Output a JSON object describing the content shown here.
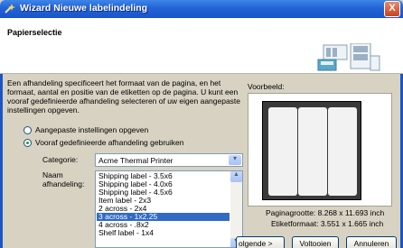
{
  "window": {
    "title": "Wizard Nieuwe labelindeling",
    "close_label": "X"
  },
  "header": {
    "title": "Papierselectie"
  },
  "description": "Een afhandeling specificeert het formaat van de pagina, en het formaat, aantal en positie van de etiketten op de pagina. U kunt een vooraf gedefinieerde afhandeling selecteren of uw eigen aangepaste instellingen opgeven.",
  "options": {
    "custom_label": "Aangepaste instellingen opgeven",
    "predefined_label": "Vooraf gedefinieerde afhandeling gebruiken",
    "selected": "predefined"
  },
  "category": {
    "label": "Categorie:",
    "value": "Acme Thermal Printer"
  },
  "layout_name": {
    "label_line1": "Naam",
    "label_line2": "afhandeling:"
  },
  "layouts": [
    "Shipping label - 3.5x6",
    "Shipping label - 4.0x6",
    "Shipping label - 4.5x6",
    "Item label - 2x3",
    "2 across - 2x4",
    "3 across - 1x2.25",
    "4 across - .8x2",
    "Shelf label - 1x4"
  ],
  "selected_layout_index": 5,
  "preview": {
    "label": "Voorbeeld:",
    "page_size_label": "Paginagrootte:",
    "page_size_value": "8.268 x 11.693 inch",
    "label_format_label": "Etiketformaat:",
    "label_format_value": "3.551 x 1.665 inch"
  },
  "buttons": {
    "next": "Volgende >",
    "finish": "Voltooien",
    "cancel": "Annuleren"
  },
  "next_visible_text": "olgende >"
}
